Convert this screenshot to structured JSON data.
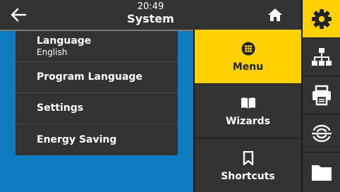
{
  "header": {
    "time": "20:49",
    "title": "System"
  },
  "submenu": {
    "items": [
      {
        "label": "Language",
        "value": "English"
      },
      {
        "label": "Program Language"
      },
      {
        "label": "Settings"
      },
      {
        "label": "Energy Saving"
      }
    ]
  },
  "menu_column": {
    "items": [
      {
        "label": "Menu",
        "icon": "dots-grid-icon",
        "active": true
      },
      {
        "label": "Wizards",
        "icon": "book-icon",
        "active": false
      },
      {
        "label": "Shortcuts",
        "icon": "bookmark-icon",
        "active": false
      }
    ]
  },
  "sidebar": {
    "items": [
      {
        "icon": "gear-icon",
        "active": true
      },
      {
        "icon": "network-icon",
        "active": false
      },
      {
        "icon": "printer-icon",
        "active": false
      },
      {
        "icon": "rfid-icon",
        "active": false
      },
      {
        "icon": "folder-icon",
        "active": false
      }
    ]
  },
  "colors": {
    "accent": "#ffd100",
    "background": "#333333",
    "pane": "#0e7cbf"
  }
}
